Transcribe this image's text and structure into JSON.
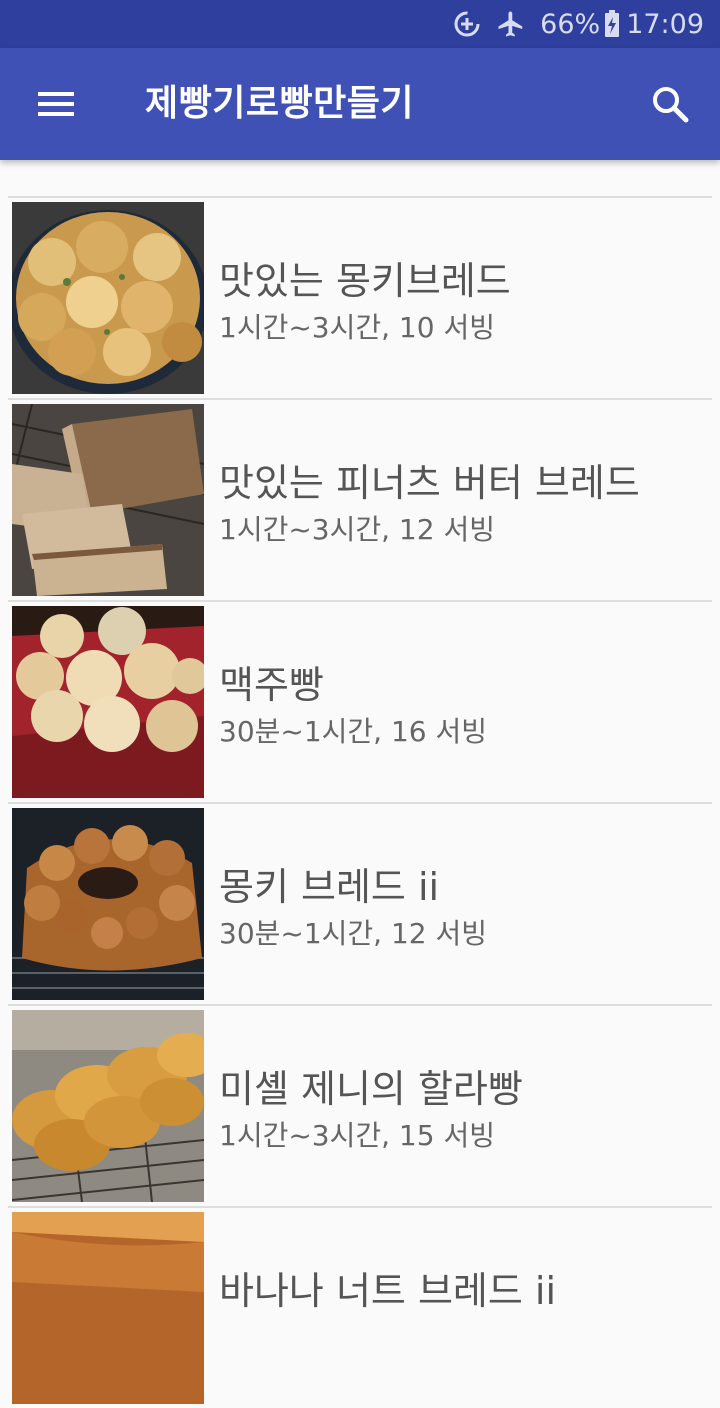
{
  "status_bar": {
    "battery": "66%",
    "time": "17:09"
  },
  "app_bar": {
    "title": "제빵기로빵만들기",
    "menu_icon": "hamburger-menu-icon",
    "search_icon": "search-icon"
  },
  "recipes": [
    {
      "title": "맛있는 몽키브레드",
      "subtitle": "1시간~3시간, 10 서빙"
    },
    {
      "title": "맛있는 피너츠 버터 브레드",
      "subtitle": "1시간~3시간, 12 서빙"
    },
    {
      "title": "맥주빵",
      "subtitle": "30분~1시간, 16 서빙"
    },
    {
      "title": "몽키 브레드 ii",
      "subtitle": "30분~1시간, 12 서빙"
    },
    {
      "title": "미셸 제니의 할라빵",
      "subtitle": "1시간~3시간, 15 서빙"
    },
    {
      "title": "바나나 너트 브레드 ii",
      "subtitle": ""
    }
  ],
  "colors": {
    "status_bar": "#2f3f9e",
    "app_bar": "#3f51b5",
    "background": "#fafafa"
  }
}
